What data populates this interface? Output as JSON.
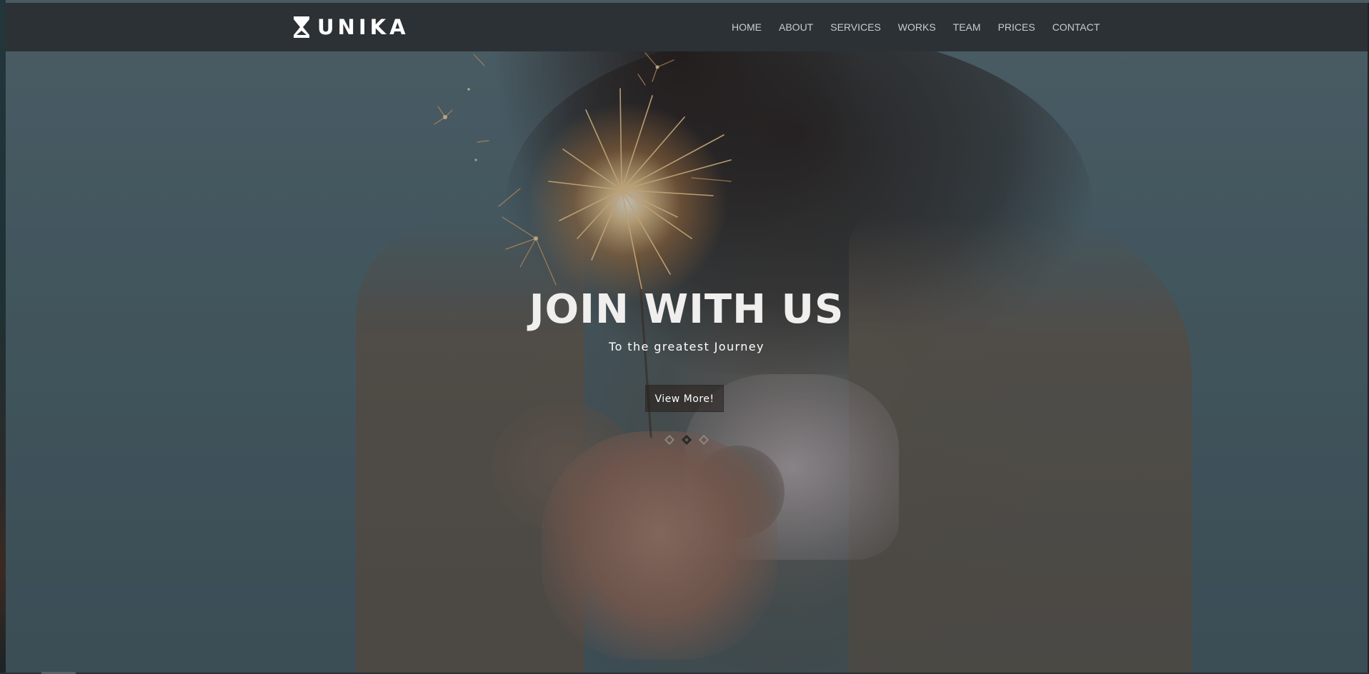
{
  "brand": {
    "logo_text": "UNIKA",
    "logo_icon": "hourglass-logo-icon"
  },
  "nav": {
    "items": [
      {
        "label": "HOME"
      },
      {
        "label": "ABOUT"
      },
      {
        "label": "SERVICES"
      },
      {
        "label": "WORKS"
      },
      {
        "label": "TEAM"
      },
      {
        "label": "PRICES"
      },
      {
        "label": "CONTACT"
      }
    ]
  },
  "hero": {
    "title": "JOIN WITH US",
    "subtitle": "To the greatest Journey",
    "button_label": "View More!",
    "slides": {
      "count": 3,
      "active_index": 1
    },
    "background_description_icon": "sparkler-photo"
  },
  "colors": {
    "navbar_bg": "#2b3135",
    "nav_text": "#c9ccce",
    "title_text": "#f1eeee"
  }
}
